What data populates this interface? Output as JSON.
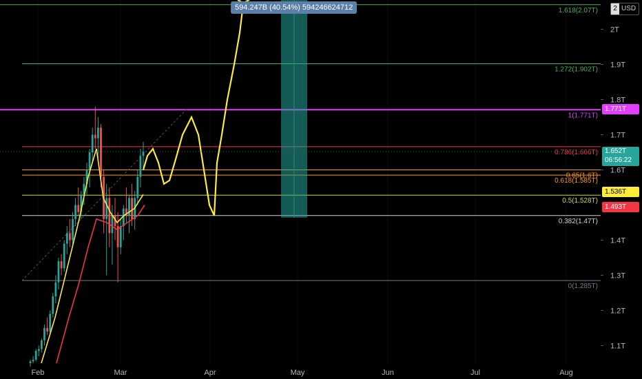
{
  "chart_data": {
    "type": "candlestick",
    "x_labels": [
      "Feb",
      "Mar",
      "Apr",
      "May",
      "Jun",
      "Jul",
      "Aug"
    ],
    "y_ticks": [
      "2T",
      "1.9T",
      "1.8T",
      "1.7T",
      "1.6T",
      "1.4T",
      "1.3T",
      "1.2T",
      "1.1T"
    ],
    "y_tick_values": [
      2.0,
      1.9,
      1.8,
      1.7,
      1.6,
      1.4,
      1.3,
      1.2,
      1.1
    ],
    "ylim": [
      1.05,
      2.09
    ],
    "fib_levels": [
      {
        "value": 2.07,
        "label": "1.618(2.07T)",
        "color": "#4caf50"
      },
      {
        "value": 1.902,
        "label": "1.272(1.902T)",
        "color": "#4caf50"
      },
      {
        "value": 1.771,
        "label": "1(1.771T)",
        "color": "#e040fb"
      },
      {
        "value": 1.666,
        "label": "0.786(1.666T)",
        "color": "#f23645"
      },
      {
        "value": 1.6,
        "label": "0.65(1.6T)",
        "color": "#ff9800"
      },
      {
        "value": 1.585,
        "label": "0.618(1.585T)",
        "color": "#ff9800"
      },
      {
        "value": 1.528,
        "label": "0.5(1.528T)",
        "color": "#cddc39"
      },
      {
        "value": 1.47,
        "label": "0.382(1.47T)",
        "color": "#d1d4dc"
      },
      {
        "value": 1.285,
        "label": "0(1.285T)",
        "color": "#787b86"
      }
    ],
    "price_badges": [
      {
        "value": 1.771,
        "label": "1.771T",
        "bg": "#e040fb",
        "fg": "#ffffff"
      },
      {
        "value": 1.536,
        "label": "1.536T",
        "bg": "#ffeb3b",
        "fg": "#000000"
      },
      {
        "value": 1.493,
        "label": "1.493T",
        "bg": "#f23645",
        "fg": "#ffffff"
      }
    ],
    "current_price": {
      "value": 1.652,
      "label": "1.652T",
      "countdown": "06:56:22",
      "bg": "#26a69a"
    },
    "measure_label": "594.247B (40.54%) 594246624712",
    "currency": "USD",
    "currency_axis_label": "2",
    "colors": {
      "up": "#26a69a",
      "down": "#ef5350",
      "ma_fast": "#ffeb3b",
      "ma_slow": "#f23645",
      "projection": "#ffeb3b",
      "target_box": "#26a69a"
    }
  }
}
